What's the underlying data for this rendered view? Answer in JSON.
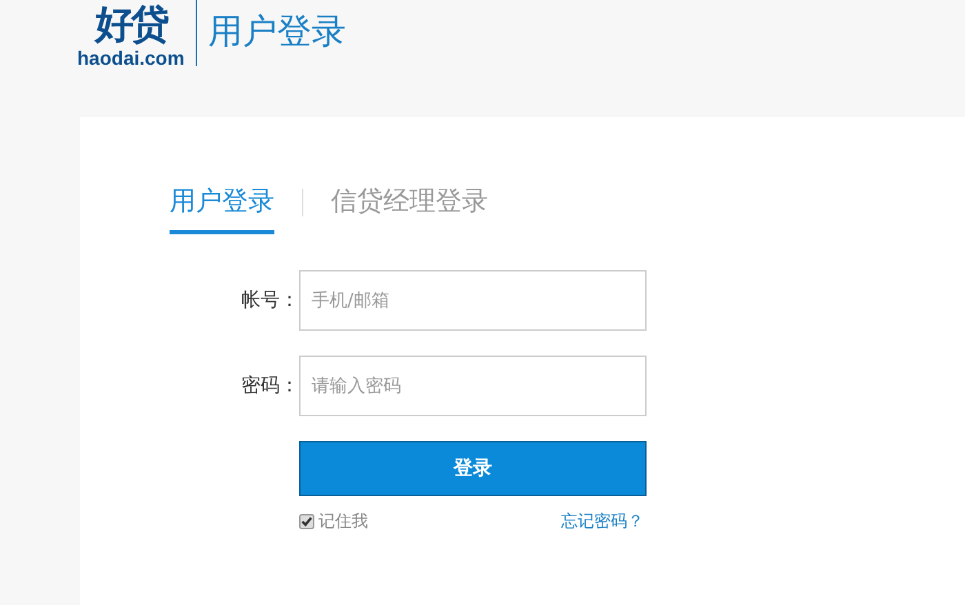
{
  "header": {
    "logo": "好贷",
    "logo_domain": "haodai.com",
    "title": "用户登录"
  },
  "tabs": [
    {
      "label": "用户登录",
      "selected": true
    },
    {
      "label": "信贷经理登录",
      "selected": false
    }
  ],
  "fields": [
    {
      "label": "帐号：",
      "placeholder": "手机/邮箱"
    },
    {
      "label": "密码：",
      "placeholder": "请输入密码"
    }
  ],
  "login_button": "登录",
  "remember": {
    "label": "记住我",
    "checked": true
  },
  "forgot_link": "忘记密码？"
}
